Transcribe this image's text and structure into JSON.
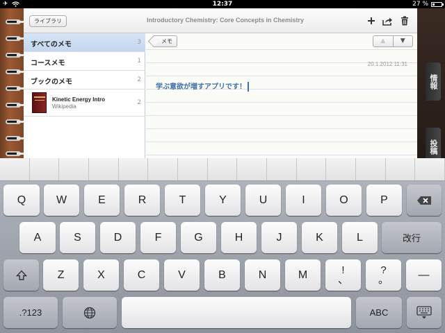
{
  "status_bar": {
    "time": "12:37",
    "battery_label": "27 %",
    "battery_level": 0.27
  },
  "toolbar": {
    "library_label": "ライブラリ",
    "title": "Introductory Chemistry: Core Concepts in Chemistry",
    "icons": [
      "plus-icon",
      "share-icon",
      "trash-icon"
    ]
  },
  "sidebar": {
    "items": [
      {
        "label": "すべてのメモ",
        "count": "3"
      },
      {
        "label": "コースメモ",
        "count": "1"
      },
      {
        "label": "ブックのメモ",
        "count": "2"
      }
    ],
    "book": {
      "name": "Kinetic Energy Intro",
      "source": "Wikipedia",
      "count": "2"
    }
  },
  "note": {
    "back_label": "メモ",
    "prev_label": "▲",
    "next_label": "▼",
    "date": "20.1.2012 11:31",
    "text": "学ぶ意欲が増すアプリです！"
  },
  "tabs": [
    {
      "label": "情報"
    },
    {
      "label": "投稿"
    }
  ],
  "keyboard": {
    "row1": [
      "Q",
      "W",
      "E",
      "R",
      "T",
      "Y",
      "U",
      "I",
      "O",
      "P"
    ],
    "row2": [
      "A",
      "S",
      "D",
      "F",
      "G",
      "H",
      "J",
      "K",
      "L"
    ],
    "row3": [
      "Z",
      "X",
      "C",
      "V",
      "B",
      "N",
      "M"
    ],
    "return_label": "改行",
    "excl_top": "!",
    "excl_bottom": "、",
    "quest_top": "?",
    "quest_bottom": "。",
    "dash": "—",
    "numbers_label": ".?123",
    "abc_label": "ABC",
    "icons": [
      "backspace-icon",
      "shift-icon",
      "globe-icon",
      "hide-keyboard-icon"
    ]
  }
}
